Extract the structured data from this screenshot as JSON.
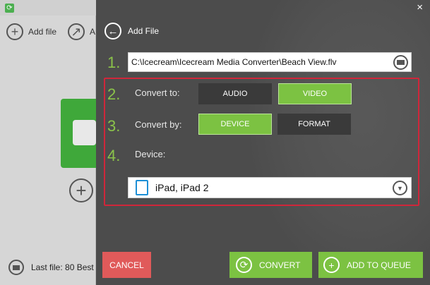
{
  "background_app": {
    "toolbar": {
      "add_file_label": "Add file",
      "second_item_label": "A"
    },
    "last_file_label": "Last file: 80 Best"
  },
  "dialog": {
    "close_label": "×",
    "back_label": "Add File",
    "step1_number": "1.",
    "file_path": "C:\\Icecream\\Icecream Media Converter\\Beach View.flv",
    "step2_number": "2.",
    "convert_to_label": "Convert to:",
    "convert_to_options": [
      "AUDIO",
      "VIDEO"
    ],
    "convert_to_selected": "VIDEO",
    "step3_number": "3.",
    "convert_by_label": "Convert by:",
    "convert_by_options": [
      "DEVICE",
      "FORMAT"
    ],
    "convert_by_selected": "DEVICE",
    "step4_number": "4.",
    "device_label": "Device:",
    "device_value": "iPad, iPad 2",
    "cancel_label": "CANCEL",
    "convert_label": "CONVERT",
    "add_to_queue_label": "ADD TO QUEUE"
  },
  "colors": {
    "accent_green": "#7cc242",
    "cancel_red": "#e05a5a",
    "highlight_border": "#d0263a",
    "step_number": "#8bc34a"
  },
  "icons": [
    "app-logo-icon",
    "add-file-icon",
    "share-icon",
    "plus-icon",
    "folder-icon",
    "back-arrow-icon",
    "close-icon",
    "tablet-icon",
    "dropdown-icon",
    "refresh-icon",
    "plus-circle-icon"
  ]
}
